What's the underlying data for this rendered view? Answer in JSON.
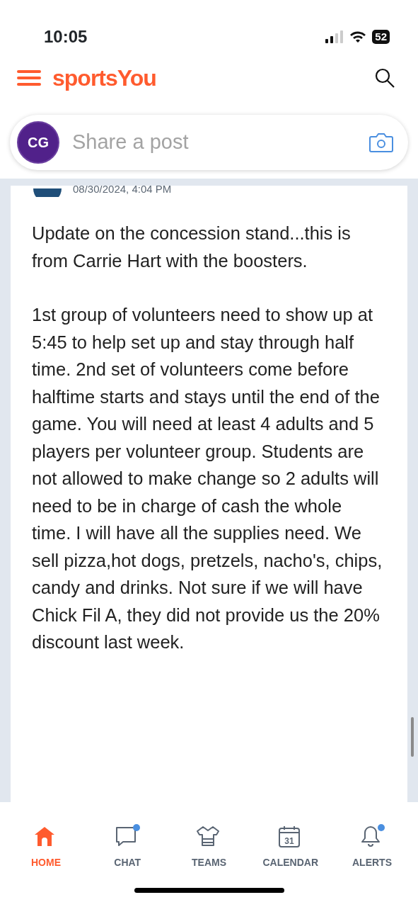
{
  "status_bar": {
    "time": "10:05",
    "battery": "52"
  },
  "header": {
    "logo": "sportsYou"
  },
  "composer": {
    "avatar_initials": "CG",
    "placeholder": "Share a post"
  },
  "post": {
    "timestamp": "08/30/2024, 4:04 PM",
    "paragraphs": [
      "Update on the concession stand...this is from Carrie Hart with the boosters.",
      "1st group of volunteers need to show up at 5:45 to help set up and stay through half time.  2nd set of volunteers come before halftime starts and stays until the end of the game.  You will need at least 4 adults and 5 players per volunteer group.  Students are not allowed to make change so 2 adults will need to be in charge of cash the whole time.  I will have all the supplies need.  We sell pizza,hot dogs, pretzels, nacho's, chips, candy and drinks.  Not sure if we will have Chick Fil A, they did not provide us the 20% discount last week."
    ]
  },
  "tab_bar": [
    {
      "kind": "home",
      "label": "HOME",
      "selected": true,
      "badge": false
    },
    {
      "kind": "chat",
      "label": "CHAT",
      "selected": false,
      "badge": true
    },
    {
      "kind": "teams",
      "label": "TEAMS",
      "selected": false,
      "badge": false
    },
    {
      "kind": "calendar",
      "label": "CALENDAR",
      "selected": false,
      "badge": false,
      "day": "31"
    },
    {
      "kind": "alerts",
      "label": "ALERTS",
      "selected": false,
      "badge": true
    }
  ]
}
